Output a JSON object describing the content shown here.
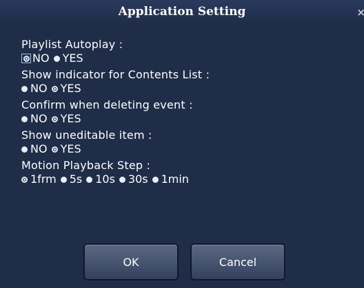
{
  "dialog": {
    "title": "Application Setting",
    "close_glyph": "×"
  },
  "settings": [
    {
      "label": "Playlist Autoplay :",
      "options": [
        {
          "label": "NO",
          "checked": true,
          "focused": true
        },
        {
          "label": "YES",
          "checked": false
        }
      ]
    },
    {
      "label": "Show indicator for Contents List :",
      "options": [
        {
          "label": "NO",
          "checked": false
        },
        {
          "label": "YES",
          "checked": true
        }
      ]
    },
    {
      "label": "Confirm when deleting event :",
      "options": [
        {
          "label": "NO",
          "checked": false
        },
        {
          "label": "YES",
          "checked": true
        }
      ]
    },
    {
      "label": "Show uneditable item :",
      "options": [
        {
          "label": "NO",
          "checked": false
        },
        {
          "label": "YES",
          "checked": true
        }
      ]
    },
    {
      "label": "Motion Playback Step :",
      "options": [
        {
          "label": "1frm",
          "checked": true
        },
        {
          "label": "5s",
          "checked": false
        },
        {
          "label": "10s",
          "checked": false
        },
        {
          "label": "30s",
          "checked": false
        },
        {
          "label": "1min",
          "checked": false
        }
      ]
    }
  ],
  "buttons": {
    "ok_label": "OK",
    "cancel_label": "Cancel"
  }
}
